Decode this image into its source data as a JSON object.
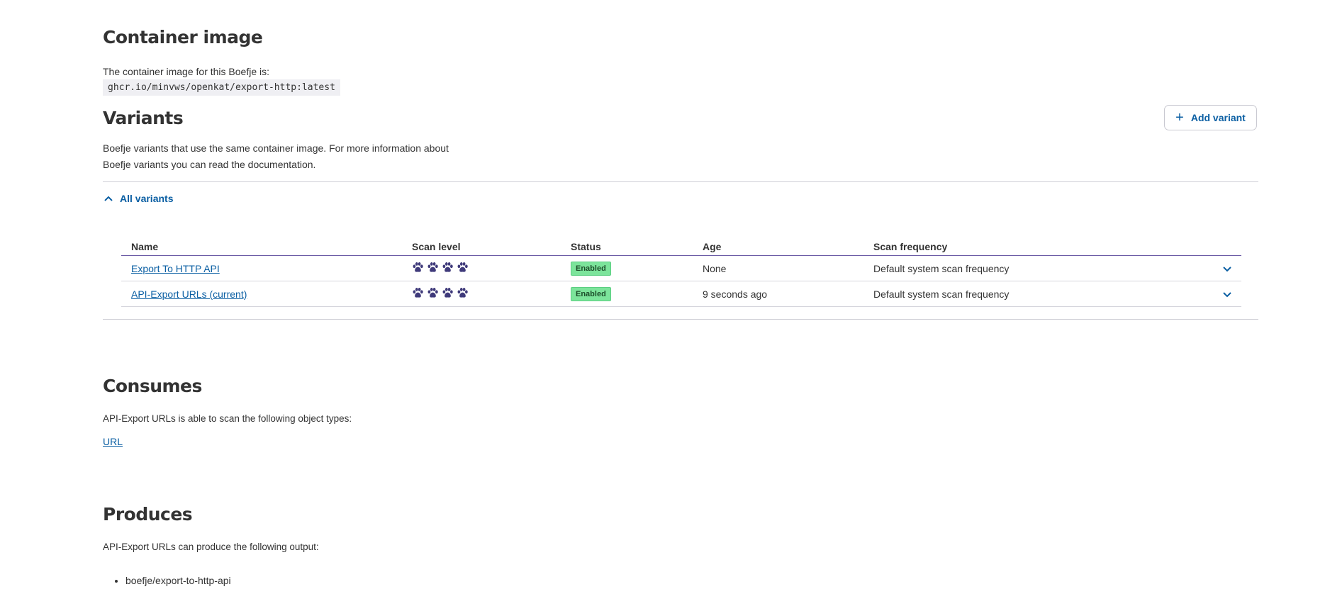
{
  "container": {
    "title": "Container image",
    "description": "The container image for this Boefje is:",
    "image": "ghcr.io/minvws/openkat/export-http:latest"
  },
  "variants": {
    "title": "Variants",
    "add_button": "Add variant",
    "description_line1": "Boefje variants that use the same container image. For more information about",
    "description_line2": "Boefje variants you can read the documentation.",
    "toggle_label": "All variants",
    "columns": {
      "name": "Name",
      "scan_level": "Scan level",
      "status": "Status",
      "age": "Age",
      "scan_frequency": "Scan frequency"
    },
    "rows": [
      {
        "name": "Export To HTTP API",
        "scan_level": 4,
        "status": "Enabled",
        "age": "None",
        "scan_frequency": "Default system scan frequency"
      },
      {
        "name": "API-Export URLs (current)",
        "scan_level": 4,
        "status": "Enabled",
        "age": "9 seconds ago",
        "scan_frequency": "Default system scan frequency"
      }
    ]
  },
  "consumes": {
    "title": "Consumes",
    "description": "API-Export URLs is able to scan the following object types:",
    "types": [
      "URL"
    ]
  },
  "produces": {
    "title": "Produces",
    "description": "API-Export URLs can produce the following output:",
    "outputs": [
      "boefje/export-to-http-api"
    ]
  },
  "colors": {
    "link": "#0b5fa3",
    "paw": "#3f3a7a",
    "badge_bg": "#7ce49b",
    "header_rule": "#6b5ba6"
  }
}
